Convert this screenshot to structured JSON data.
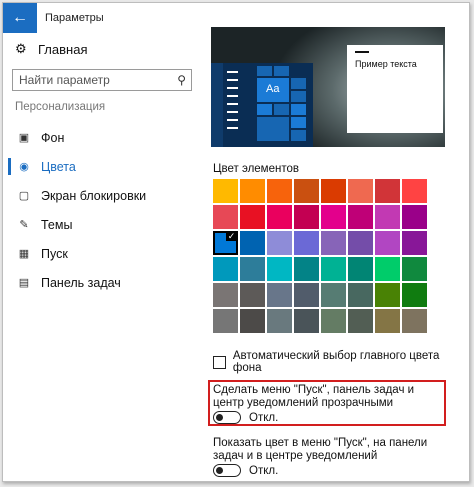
{
  "titlebar": {
    "title": "Параметры"
  },
  "sidebar": {
    "home_label": "Главная",
    "search_placeholder": "Найти параметр",
    "section_label": "Персонализация",
    "items": [
      {
        "label": "Фон",
        "icon": "image-icon"
      },
      {
        "label": "Цвета",
        "icon": "palette-icon",
        "active": true
      },
      {
        "label": "Экран блокировки",
        "icon": "monitor-icon"
      },
      {
        "label": "Темы",
        "icon": "brush-icon"
      },
      {
        "label": "Пуск",
        "icon": "start-icon"
      },
      {
        "label": "Панель задач",
        "icon": "taskbar-icon"
      }
    ]
  },
  "preview": {
    "tile_text": "Aa",
    "sample_text": "Пример текста"
  },
  "colors": {
    "label": "Цвет элементов",
    "swatches": [
      "#ffb900",
      "#ff8c00",
      "#f7630c",
      "#ca5010",
      "#da3b01",
      "#ef6950",
      "#d13438",
      "#ff4343",
      "#e74856",
      "#e81123",
      "#ea005e",
      "#c30052",
      "#e3008c",
      "#bf0077",
      "#c239b3",
      "#9a0089",
      "#0078d7",
      "#0063b1",
      "#8e8cd8",
      "#6b69d6",
      "#8764b8",
      "#744da9",
      "#b146c2",
      "#881798",
      "#0099bc",
      "#2d7d9a",
      "#00b7c3",
      "#038387",
      "#00b294",
      "#018574",
      "#00cc6a",
      "#10893e",
      "#7a7574",
      "#5d5a58",
      "#68768a",
      "#515c6b",
      "#567c73",
      "#486860",
      "#498205",
      "#107c10",
      "#767676",
      "#4c4a48",
      "#69797e",
      "#4a5459",
      "#647c64",
      "#525e54",
      "#847545",
      "#7e735f"
    ],
    "selected_index": 16
  },
  "options": {
    "auto_color_label": "Автоматический выбор главного цвета фона",
    "transparency_text": "Сделать меню \"Пуск\", панель задач и центр уведомлений прозрачными",
    "transparency_state": "Откл.",
    "show_color_text": "Показать цвет в меню \"Пуск\", на панели задач и в центре уведомлений",
    "show_color_state": "Откл."
  }
}
